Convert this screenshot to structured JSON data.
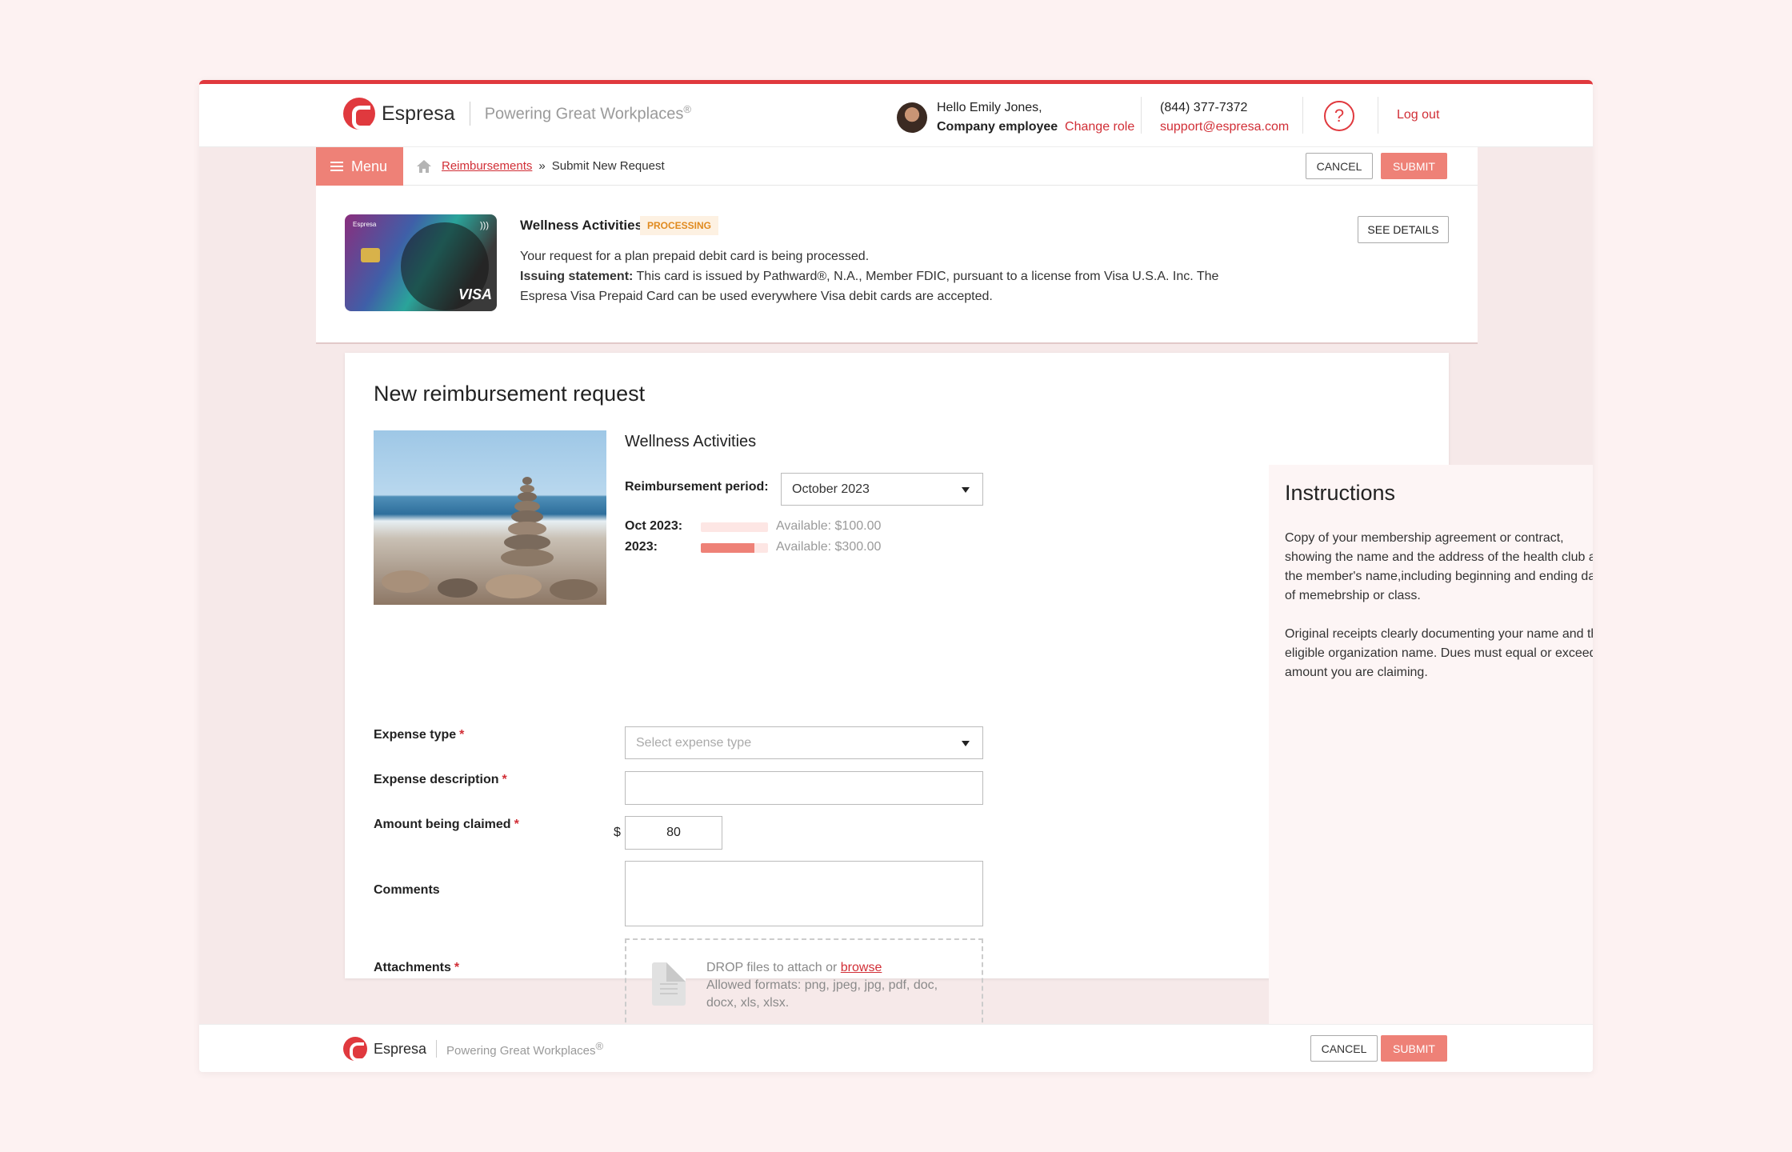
{
  "header": {
    "brand": "Espresa",
    "tagline": "Powering Great Workplaces",
    "tagline_mark": "®",
    "greeting": "Hello Emily Jones,",
    "role": "Company employee",
    "change_role": "Change role",
    "phone": "(844) 377-7372",
    "email": "support@espresa.com",
    "help": "?",
    "logout": "Log out"
  },
  "nav": {
    "menu": "Menu",
    "breadcrumb_link": "Reimbursements",
    "breadcrumb_sep": "»",
    "breadcrumb_current": "Submit New Request",
    "cancel": "CANCEL",
    "submit": "SUBMIT"
  },
  "card": {
    "brand": "Espresa",
    "network": "VISA",
    "title": "Wellness Activities",
    "status": "PROCESSING",
    "line1": "Your request for a plan prepaid debit card is being processed.",
    "statement_label": "Issuing statement:",
    "statement_text": " This card is issued by Pathward®, N.A., Member FDIC, pursuant to a license from Visa U.S.A. Inc. The Espresa Visa Prepaid Card can be used everywhere Visa debit cards are accepted.",
    "see_details": "SEE DETAILS"
  },
  "form": {
    "title": "New reimbursement request",
    "program": "Wellness Activities",
    "period_label": "Reimbursement period:",
    "period_value": "October 2023",
    "limits": [
      {
        "label": "Oct 2023:",
        "used_fraction": 0.0,
        "available": "Available: $100.00"
      },
      {
        "label": "2023:",
        "used_fraction": 0.8,
        "available": "Available: $300.00"
      }
    ],
    "expense_type_label": "Expense type",
    "expense_type_placeholder": "Select expense type",
    "expense_desc_label": "Expense description",
    "expense_desc_value": "",
    "amount_label": "Amount being claimed",
    "currency": "$",
    "amount_value": "80",
    "comments_label": "Comments",
    "comments_value": "",
    "attachments_label": "Attachments",
    "required_mark": "*",
    "drop_text": "DROP files to attach or ",
    "browse": "browse",
    "formats": "Allowed formats: png, jpeg, jpg, pdf, doc, docx, xls, xlsx."
  },
  "instructions": {
    "title": "Instructions",
    "p1": "Copy of your membership agreement or contract, showing the name and the address of the health club and the member's name,including beginning and ending dates of memebrship or class.",
    "p2": "Original receipts clearly documenting your name and the eligible organization name. Dues must equal or exceed amount you are claiming."
  },
  "footer": {
    "brand": "Espresa",
    "tagline": "Powering Great Workplaces",
    "tagline_mark": "®",
    "cancel": "CANCEL",
    "submit": "SUBMIT"
  },
  "colors": {
    "accent": "#e0393e",
    "button": "#ee8177",
    "badge_text": "#e08a1f"
  }
}
